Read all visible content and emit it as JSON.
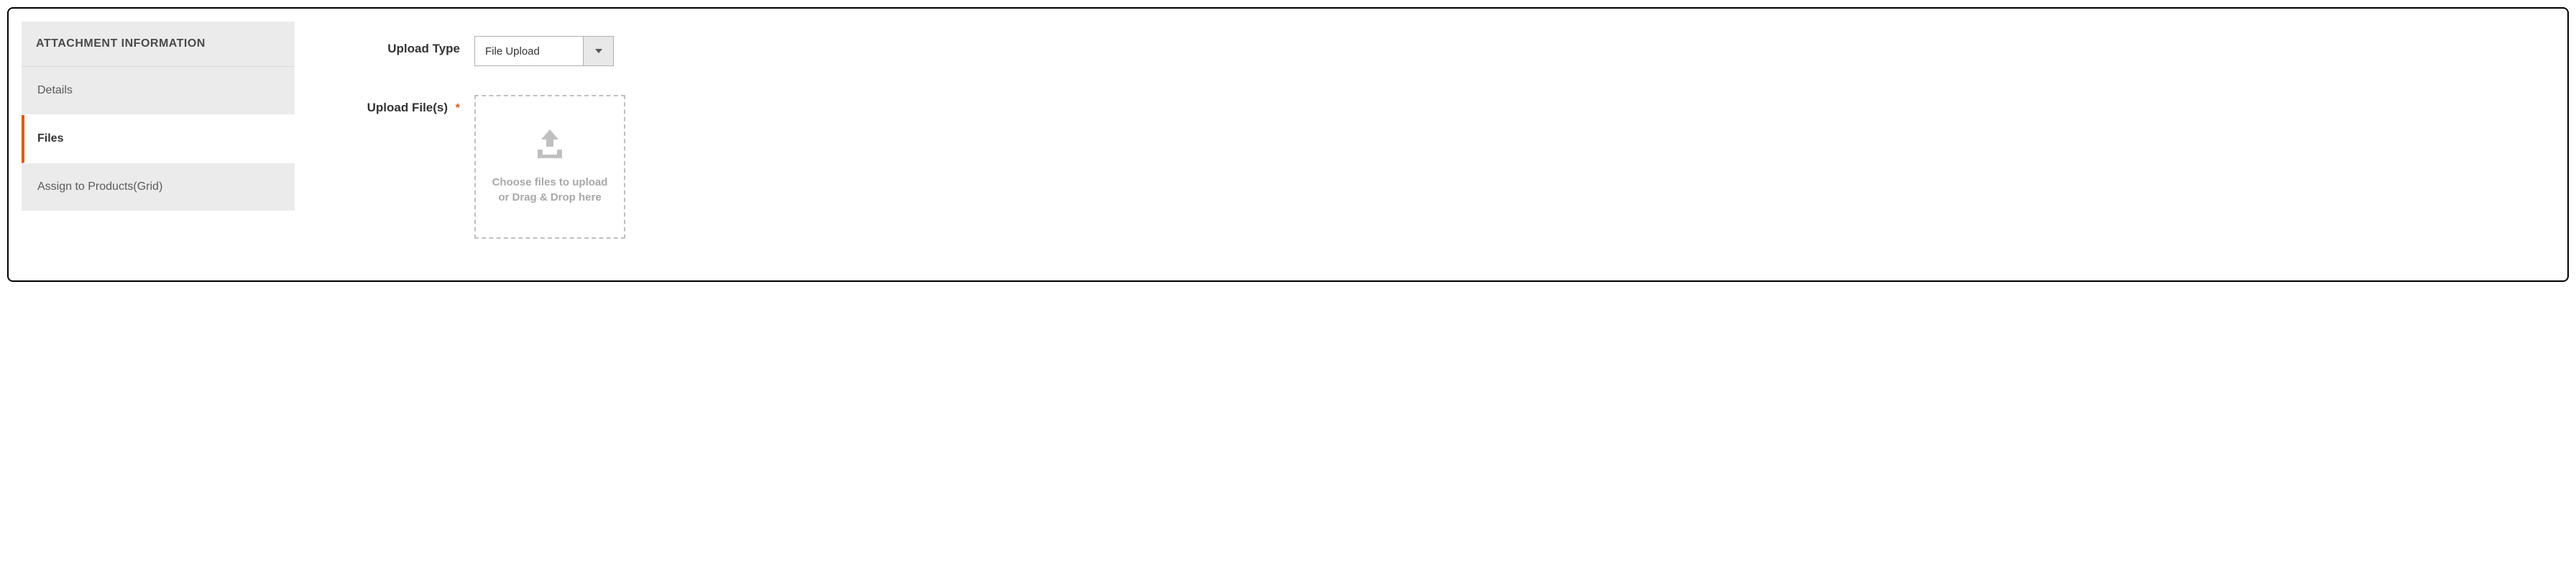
{
  "sidebar": {
    "header": "ATTACHMENT INFORMATION",
    "items": [
      {
        "label": "Details"
      },
      {
        "label": "Files"
      },
      {
        "label": "Assign to Products(Grid)"
      }
    ]
  },
  "form": {
    "upload_type_label": "Upload Type",
    "upload_type_value": "File Upload",
    "upload_files_label": "Upload File(s)",
    "dropzone_text": "Choose files to upload or Drag & Drop here"
  }
}
